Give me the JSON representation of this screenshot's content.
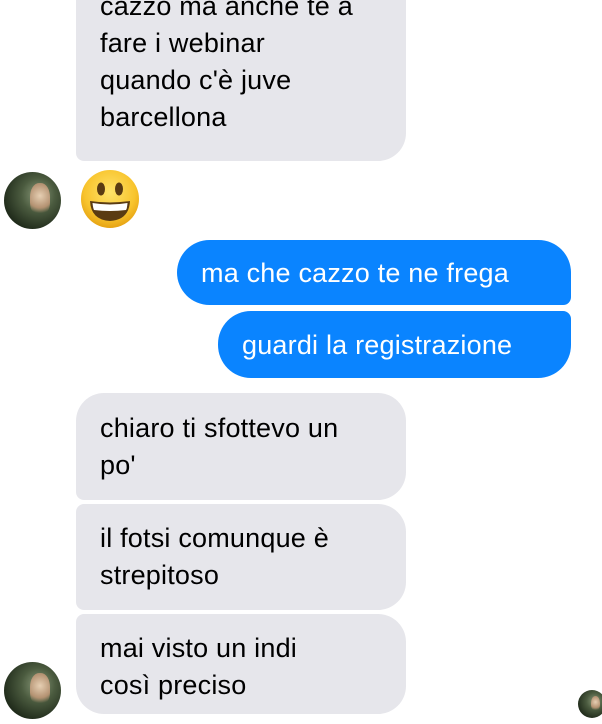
{
  "conversation": {
    "messages": [
      {
        "direction": "incoming",
        "text": "cazzo ma anche te a\nfare i webinar\nquando c'è juve\nbarcellona"
      },
      {
        "direction": "outgoing",
        "text": "ma che cazzo te ne frega"
      },
      {
        "direction": "outgoing",
        "text": "guardi la registrazione"
      },
      {
        "direction": "incoming",
        "text": "chiaro ti sfottevo un\npo'"
      },
      {
        "direction": "incoming",
        "text": "il fotsi comunque è\nstrepitoso"
      },
      {
        "direction": "incoming",
        "text": "mai visto un indi\ncosì preciso"
      }
    ],
    "reaction_emoji": "grinning-face-emoji"
  },
  "colors": {
    "incoming_bubble": "#e6e6eb",
    "outgoing_bubble": "#0a84ff",
    "outgoing_text": "#ffffff",
    "background": "#ffffff"
  }
}
